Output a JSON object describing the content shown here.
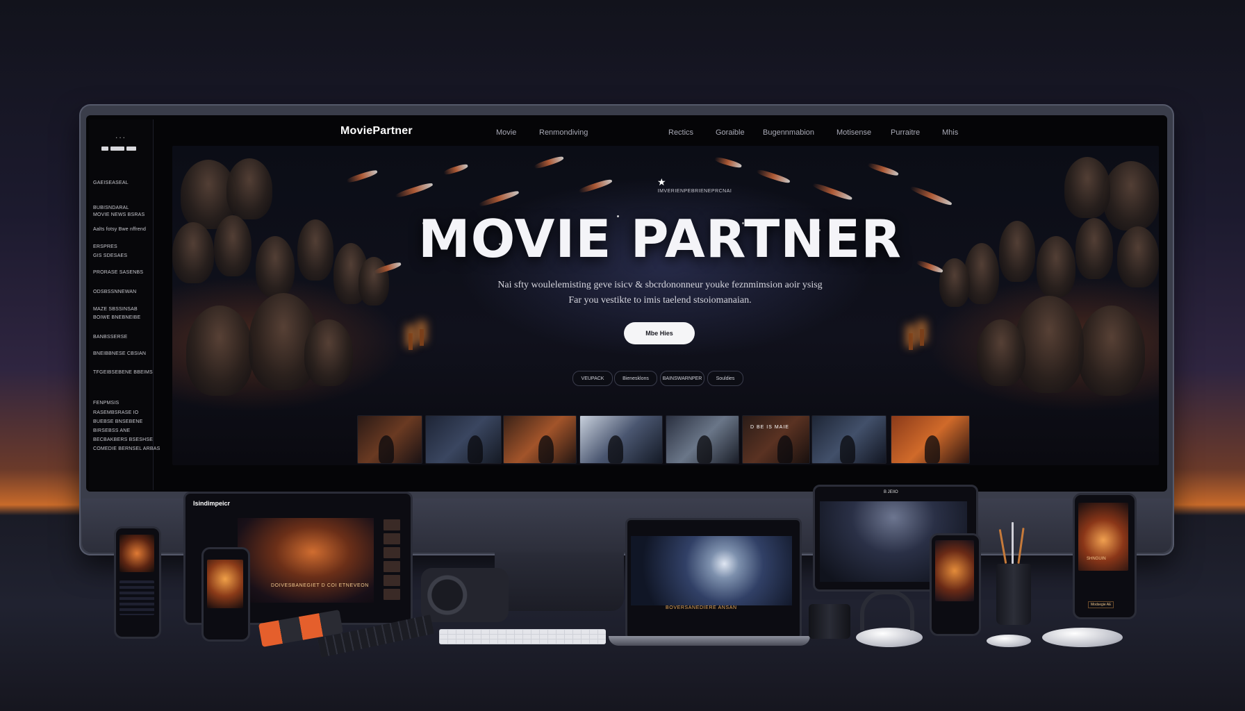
{
  "colors": {
    "accent": "#f4f4f8",
    "cta_bg": "#f5f5f7",
    "ember": "#c9663a",
    "night": "#0b0d16"
  },
  "sidebar": {
    "dots": "...",
    "items": [
      "GAEISEASEAL",
      "BUBISNDARAL",
      "MOVIE NEWS BSRAS",
      "Aalts fotsy Bwe nffrend",
      "ERSPRES",
      "GIS SDESAES",
      "PRORASE SASENBS",
      "ODSBSSNNEWAN",
      "MAZE SBSSINSAB",
      "BOIWE BNEBNEIBE",
      "BANBSSERSE",
      "BNEIBBNESE CBSIAN",
      "TFGEIBSEBENE BBEIMS",
      "FENPMSIS",
      "RASEMBSRASE IO",
      "BUEBSE BNSEBENE",
      "BIRSEBSS ANE",
      "BECBAKBERS BSESHSE",
      "COMEDIE BERNSEL ARBAS"
    ]
  },
  "nav": {
    "brand": "MoviePartner",
    "links": [
      "Movie",
      "Renmondiving",
      "Rectics",
      "Goraible",
      "Bugennmabion",
      "Motisense",
      "Purraitre",
      "Mhis"
    ]
  },
  "hero": {
    "kicker": "IMVERIENPEBRIENEPRCNAI",
    "title": "MOVIE PARTNER",
    "subtitle_line1": "Nai sfty woulelemisting geve isicv & sbcrdononneur youke feznmimsion aoir ysisg",
    "subtitle_line2": "Far you vestikte to imis taelend stsoiomanaian.",
    "cta": "Mbe Hies",
    "pills": [
      "VEUPACK",
      "Bienesklons",
      "BAINSWARNPER",
      "Souldies"
    ],
    "thumb_caption": "D BE IS MAIE"
  },
  "devices": {
    "tablet_left_logo": "Isindimpeicr",
    "tablet_left_caption": "DOIVESBANEGIET D COI ETNEVEON",
    "laptop_caption": "BOVERSANEDIERE ANSAN",
    "tablet_right_caption": "B JEIIO",
    "phone_right_caption": "SHNGUIN",
    "phone_right_button": "Modsegie AE"
  }
}
